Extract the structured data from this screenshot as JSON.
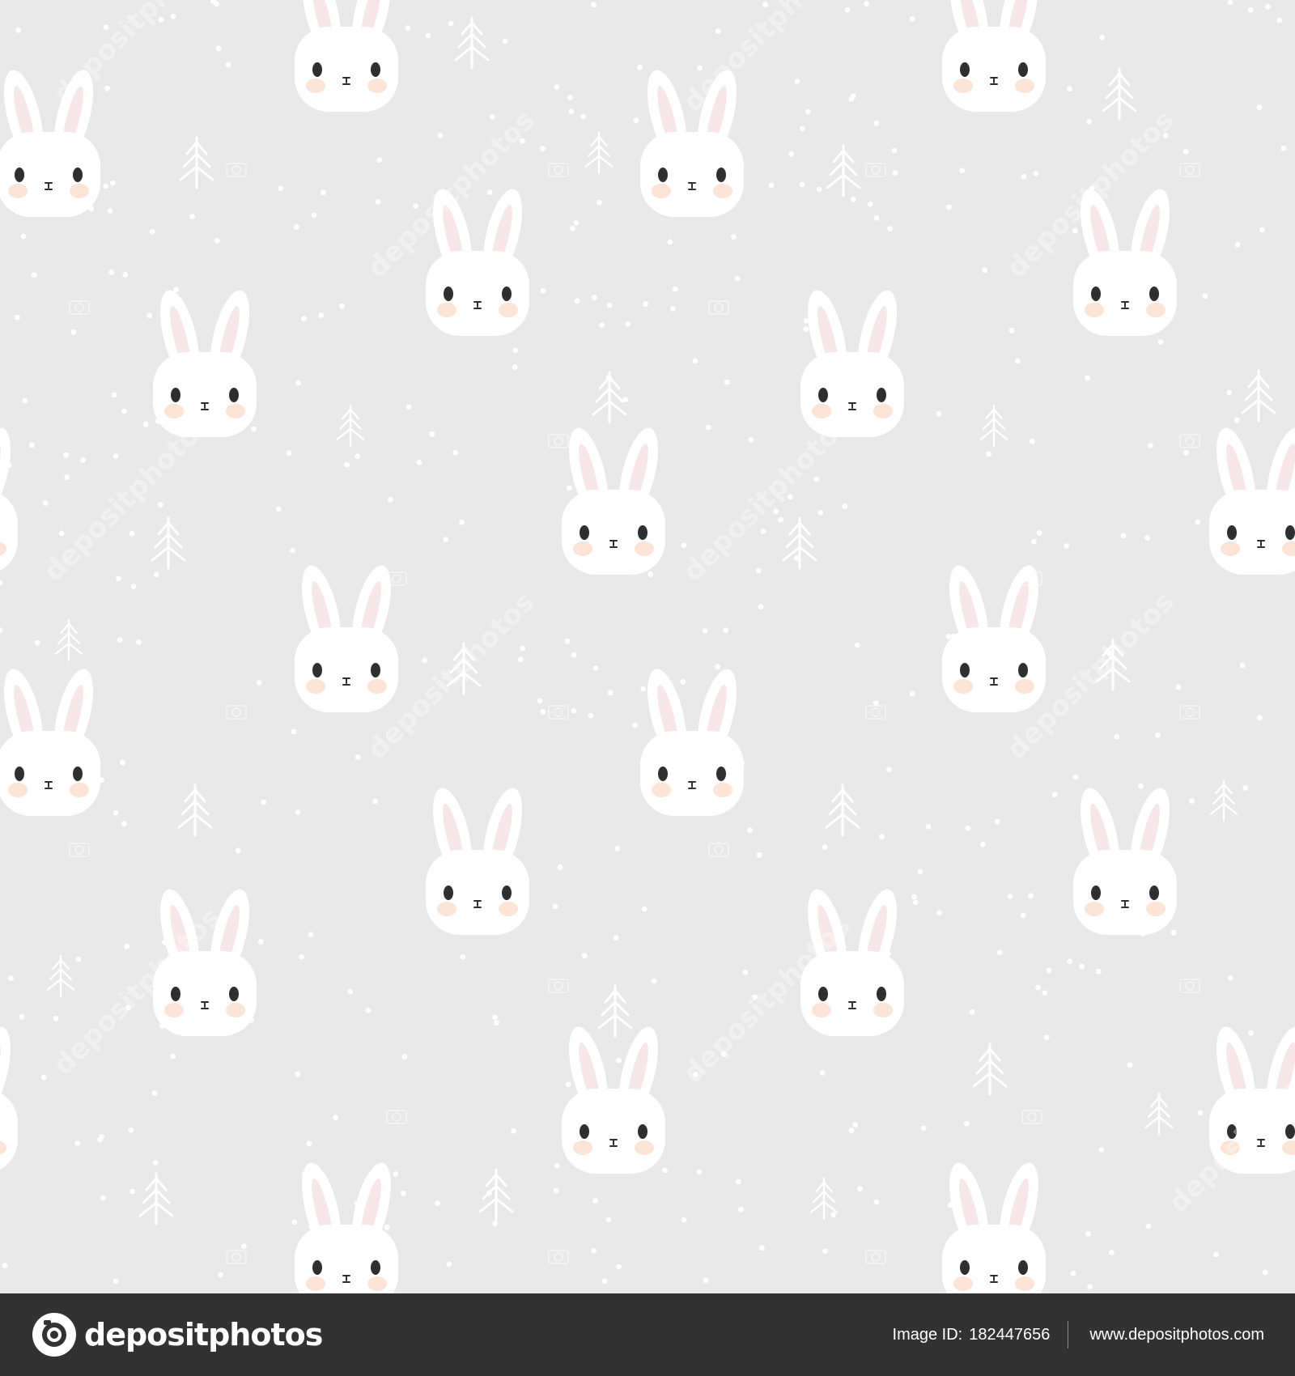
{
  "colors": {
    "background": "#e8e8e8",
    "bunny_face": "#ffffff",
    "inner_ear": "#f6e6ea",
    "cheek": "#fbe3d6",
    "eye": "#2f2f2f",
    "footer": "#323232",
    "tree": "#ffffff",
    "dot": "#ffffff"
  },
  "pattern": {
    "motifs": [
      "bunny-face-icon",
      "pine-tree-icon",
      "snow-dot-icon",
      "camera-watermark-icon"
    ],
    "watermark_text": "depositphotos"
  },
  "footer": {
    "logo_icon": "depositphotos-logo-icon",
    "logo_text": "depositphotos",
    "image_id_label": "Image ID:",
    "image_id_value": "182447656",
    "site_url": "www.depositphotos.com"
  }
}
